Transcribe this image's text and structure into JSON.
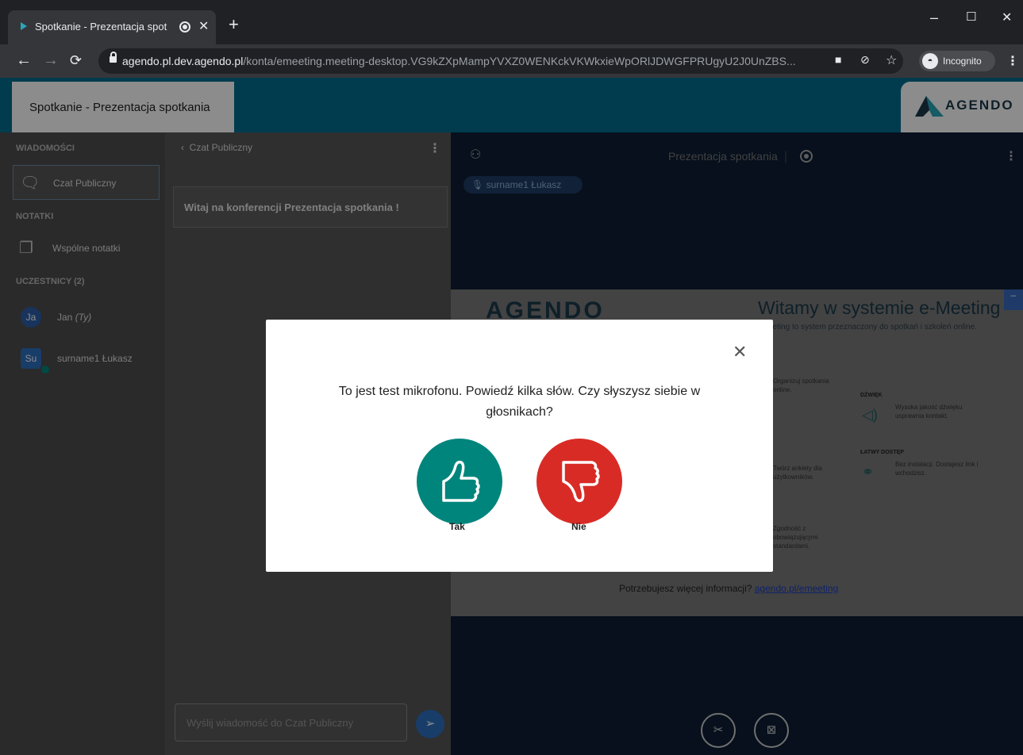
{
  "browser": {
    "tab_title": "Spotkanie - Prezentacja spot",
    "tab_close": "✕",
    "new_tab": "+",
    "url_host": "agendo.pl.dev.agendo.pl",
    "url_path": "/konta/emeeting.meeting-desktop.VG9kZXpMampYVXZ0WENKckVKWkxieWpORlJDWGFPRUgyU2J0UnZBS...",
    "incognito_label": "Incognito",
    "win_minimize": "–",
    "win_maximize": "☐",
    "win_close": "✕"
  },
  "header": {
    "page_title": "Spotkanie - Prezentacja spotkania",
    "logo_text": "AGENDO"
  },
  "sidebar": {
    "section_messages": "WIADOMOŚCI",
    "public_chat": "Czat Publiczny",
    "section_notes": "NOTATKI",
    "shared_notes": "Wspólne notatki",
    "section_participants": "UCZESTNICY (2)",
    "participants": [
      {
        "initials": "Ja",
        "name": "Jan",
        "suffix": "(Ty)"
      },
      {
        "initials": "Su",
        "name": "surname1 Łukasz"
      }
    ]
  },
  "chat": {
    "back_label": "Czat Publiczny",
    "welcome": "Witaj na konferencji Prezentacja spotkania !",
    "input_placeholder": "Wyślij wiadomość do Czat Publiczny"
  },
  "stage": {
    "title": "Prezentacja spotkania",
    "speaker_chip": "surname1 Łukasz",
    "slide": {
      "logo": "AGENDO",
      "title": "Witamy w systemie e-Meeting",
      "subtitle": "eeting to system przeznaczony do spotkań i szkoleń online.",
      "feat1": "Organizuj spotkania online.",
      "feat2_head": "DŹWIĘK",
      "feat2": "Wysoka jakość dźwięku usprawnia kontakt.",
      "feat3": "Twórz ankiety dla użytkowników.",
      "feat4_head": "ŁATWY DOSTĘP",
      "feat4": "Bez instalacji. Dostajesz link i wchodzisz.",
      "feat5": "Zgodność z obowiązującymi standardami.",
      "footer_text": "Potrzebujesz więcej informacji?",
      "footer_link": "agendo.pl/emeeting"
    }
  },
  "modal": {
    "question": "To jest test mikrofonu. Powiedź kilka słów. Czy słyszysz siebie w głosnikach?",
    "yes_label": "Tak",
    "no_label": "Nie",
    "close": "✕"
  },
  "colors": {
    "header": "#006d8f",
    "yes": "#00857c",
    "no": "#d92b26"
  }
}
